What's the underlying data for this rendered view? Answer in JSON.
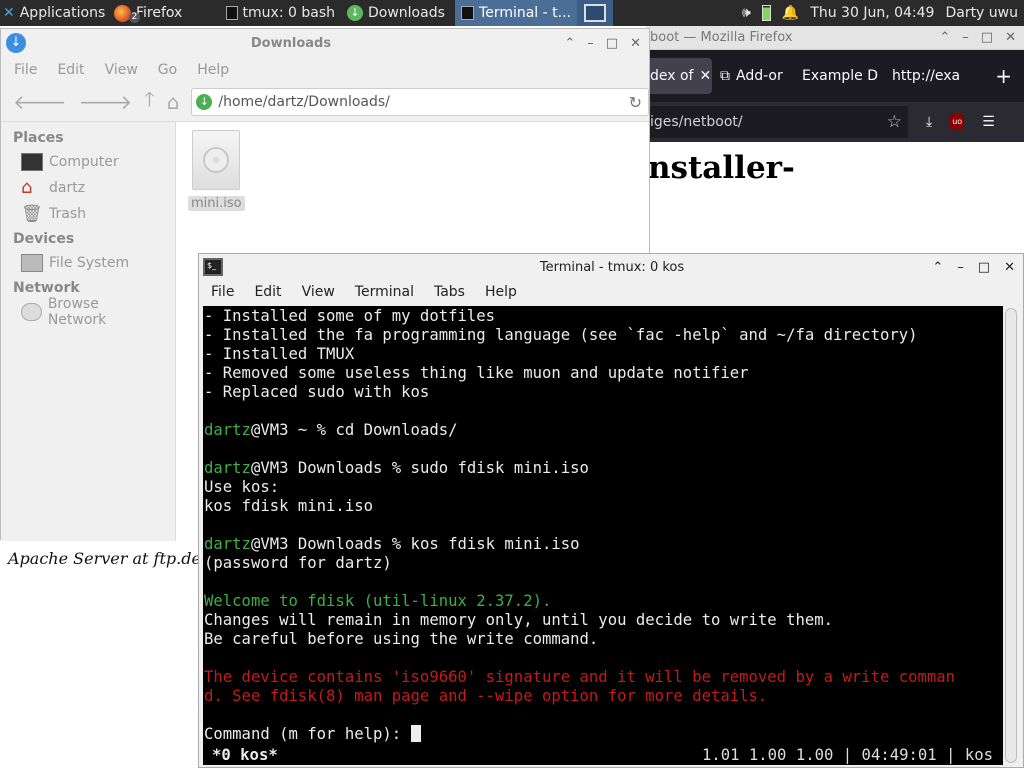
{
  "panel": {
    "applications": "Applications",
    "firefox": "Firefox",
    "firefox_badge": "2",
    "tmux": "tmux: 0 bash",
    "downloads": "Downloads",
    "terminal": "Terminal - t...",
    "datetime": "Thu 30 Jun, 04:49",
    "user": "Darty uwu"
  },
  "firefox": {
    "title": "boot — Mozilla Firefox",
    "tabs": [
      "dex of",
      "Add-or",
      "Example D",
      "http://exa"
    ],
    "url": "iges/netboot/",
    "heading": "nstaller-",
    "footer": "Apache Server at ftp.de"
  },
  "file_manager": {
    "title": "Downloads",
    "menu": [
      "File",
      "Edit",
      "View",
      "Go",
      "Help"
    ],
    "location": "/home/dartz/Downloads/",
    "sidebar": [
      {
        "header": "Places",
        "items": [
          "Computer",
          "dartz",
          "Trash"
        ]
      },
      {
        "header": "Devices",
        "items": [
          "File System"
        ]
      },
      {
        "header": "Network",
        "items": [
          "Browse Network"
        ]
      }
    ],
    "files": [
      "mini.iso"
    ]
  },
  "terminal": {
    "title": "Terminal - tmux: 0 kos",
    "menu": [
      "File",
      "Edit",
      "View",
      "Terminal",
      "Tabs",
      "Help"
    ],
    "lines": [
      {
        "prompt": "",
        "text": "- Installed some of my dotfiles",
        "color": ""
      },
      {
        "prompt": "",
        "text": "- Installed the fa programming language (see `fac -help` and ~/fa directory)",
        "color": ""
      },
      {
        "prompt": "",
        "text": "- Installed TMUX",
        "color": ""
      },
      {
        "prompt": "",
        "text": "- Removed some useless thing like muon and update notifier",
        "color": ""
      },
      {
        "prompt": "",
        "text": "- Replaced sudo with kos",
        "color": ""
      },
      {
        "prompt": "",
        "text": "",
        "color": ""
      },
      {
        "prompt": "dartz",
        "text": "@VM3 ~ % cd Downloads/",
        "color": ""
      },
      {
        "prompt": "",
        "text": "",
        "color": ""
      },
      {
        "prompt": "dartz",
        "text": "@VM3 Downloads % sudo fdisk mini.iso",
        "color": ""
      },
      {
        "prompt": "",
        "text": "Use kos:",
        "color": ""
      },
      {
        "prompt": "",
        "text": "kos fdisk mini.iso",
        "color": ""
      },
      {
        "prompt": "",
        "text": "",
        "color": ""
      },
      {
        "prompt": "dartz",
        "text": "@VM3 Downloads % kos fdisk mini.iso",
        "color": ""
      },
      {
        "prompt": "",
        "text": "(password for dartz)",
        "color": ""
      },
      {
        "prompt": "",
        "text": "",
        "color": ""
      },
      {
        "prompt": "",
        "text": "Welcome to fdisk (util-linux 2.37.2).",
        "color": "green"
      },
      {
        "prompt": "",
        "text": "Changes will remain in memory only, until you decide to write them.",
        "color": ""
      },
      {
        "prompt": "",
        "text": "Be careful before using the write command.",
        "color": ""
      },
      {
        "prompt": "",
        "text": "",
        "color": ""
      },
      {
        "prompt": "",
        "text": "The device contains 'iso9660' signature and it will be removed by a write comman",
        "color": "red"
      },
      {
        "prompt": "",
        "text": "d. See fdisk(8) man page and --wipe option for more details.",
        "color": "red"
      },
      {
        "prompt": "",
        "text": "",
        "color": ""
      }
    ],
    "command_prompt": "Command (m for help): ",
    "status_left": "*0 kos*",
    "status_right": "1.01 1.00 1.00 | 04:49:01 | kos"
  }
}
